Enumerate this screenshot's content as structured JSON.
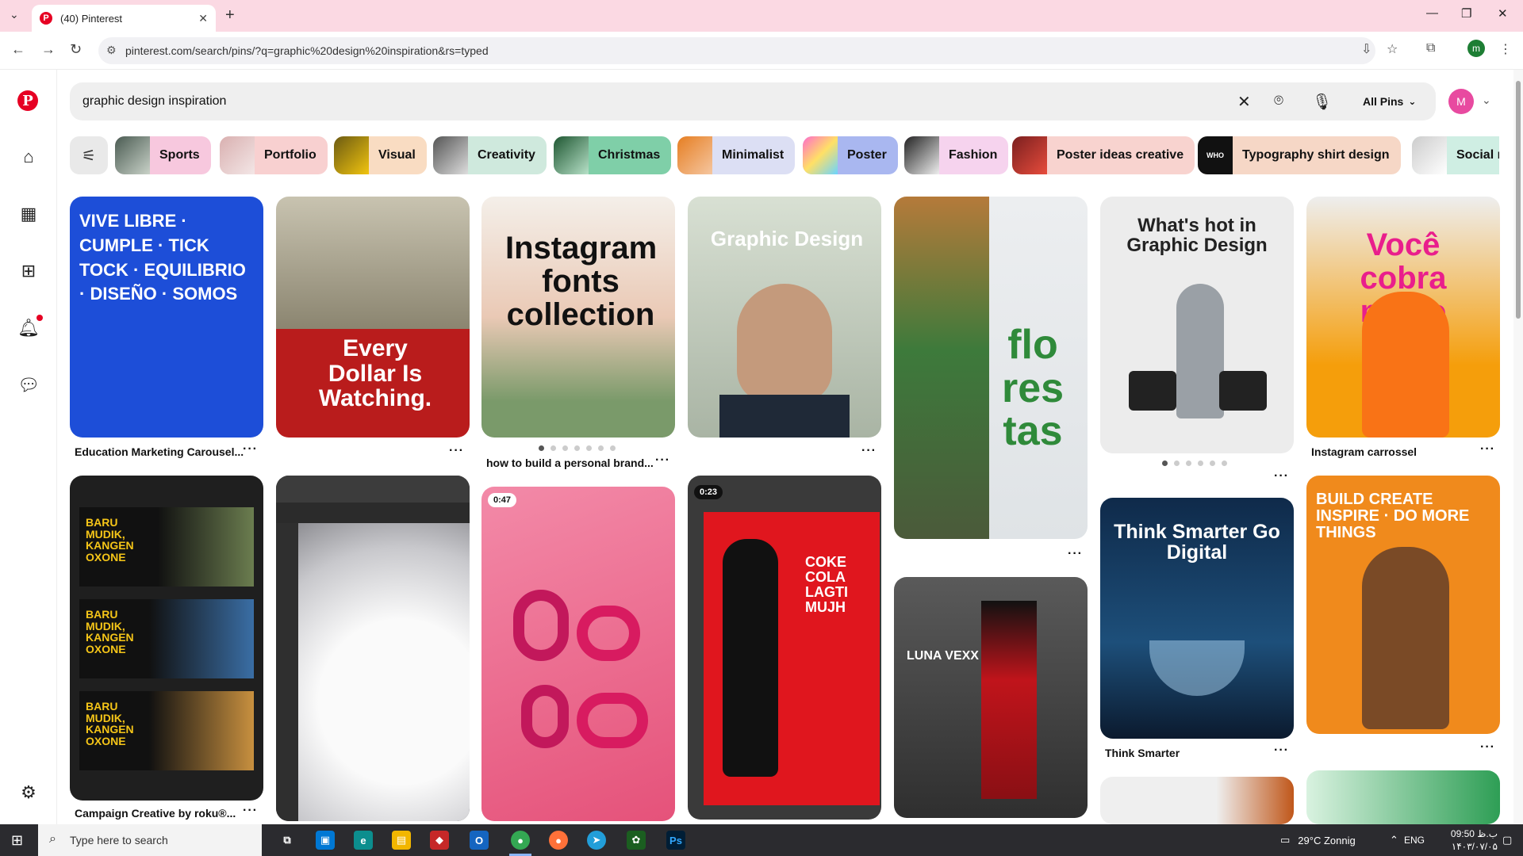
{
  "browser": {
    "tab_title": "(40) Pinterest",
    "url": "pinterest.com/search/pins/?q=graphic%20design%20inspiration&rs=typed",
    "profile_initial": "m"
  },
  "search": {
    "query": "graphic design inspiration",
    "filter_label": "All Pins",
    "avatar_initial": "M"
  },
  "chips": [
    {
      "label": "Sports",
      "bg": "#f7c8de"
    },
    {
      "label": "Portfolio",
      "bg": "#f8d0d0"
    },
    {
      "label": "Visual",
      "bg": "#f9dcc2"
    },
    {
      "label": "Creativity",
      "bg": "#cfe9dd"
    },
    {
      "label": "Christmas",
      "bg": "#7fcfa8"
    },
    {
      "label": "Minimalist",
      "bg": "#dcdff4"
    },
    {
      "label": "Poster",
      "bg": "#a9b7f0"
    },
    {
      "label": "Fashion",
      "bg": "#f6d3ee"
    },
    {
      "label": "Poster ideas creative",
      "bg": "#f8d3cf"
    },
    {
      "label": "Typography shirt design",
      "bg": "#f6d7c6"
    },
    {
      "label": "Social m",
      "bg": "#cfeee3"
    }
  ],
  "pins": [
    {
      "caption": "Education Marketing Carousel...",
      "bg": "#1d4ed8",
      "text": "VIVE LIBRE · CUMPLE · TICK TOCK · EQUILIBRIO · DISEÑO · SOMOS",
      "text_color": "#ffffff"
    },
    {
      "caption": "",
      "bg": "#b91c1c",
      "text": "Every Dollar Is Watching.",
      "text_color": "#ffffff"
    },
    {
      "caption": "how to build a personal brand...",
      "bg": "#e8d7c9",
      "text": "Instagram fonts collection",
      "text_color": "#111111"
    },
    {
      "caption": "",
      "bg": "#dfe5dc",
      "text": "Graphic Design",
      "text_color": "#ffffff"
    },
    {
      "caption": "",
      "bg": "#e9ecef",
      "text": "flo res tas",
      "text_color": "#2f8a3a"
    },
    {
      "caption": "",
      "bg": "#eeeeee",
      "text": "What's hot in Graphic Design",
      "text_color": "#222222"
    },
    {
      "caption": "Instagram carrossel",
      "bg": "#f59e0b",
      "text": "Você cobra muito caro!",
      "text_color": "#e91e8c"
    },
    {
      "caption": "Campaign Creative by roku®...",
      "bg": "#1f1f1f",
      "text": "BARU MUDIK, KANGEN OXONE",
      "text_color": "#f5c518"
    },
    {
      "caption": "",
      "bg": "#8e8e93",
      "text": "",
      "text_color": "#ffffff"
    },
    {
      "caption": "",
      "bg": "#ec6b8f",
      "text": "",
      "text_color": "#ffffff",
      "badge": "0:47"
    },
    {
      "caption": "",
      "bg": "#3a3a3a",
      "text": "COKE COLA LAGTI MUJH",
      "text_color": "#ffffff",
      "badge": "0:23"
    },
    {
      "caption": "",
      "bg": "#6b6b6b",
      "text": "LUNA VEXX",
      "text_color": "#ffffff"
    },
    {
      "caption": "Think Smarter",
      "bg": "#0f2a4a",
      "text": "Think Smarter Go Digital",
      "text_color": "#ffffff"
    },
    {
      "caption": "",
      "bg": "#f08a1c",
      "text": "BUILD CREATE INSPIRE · DO MORE THINGS",
      "text_color": "#ffffff"
    }
  ],
  "colors": {
    "accent": "#e60023",
    "chrome_tab_bg": "#fbd9e3"
  },
  "taskbar": {
    "search_placeholder": "Type here to search",
    "weather": "29°C  Zonnig",
    "lang": "ENG",
    "time": "09:50 ب.ظ",
    "date": "۱۴۰۳/۰۷/۰۵"
  }
}
